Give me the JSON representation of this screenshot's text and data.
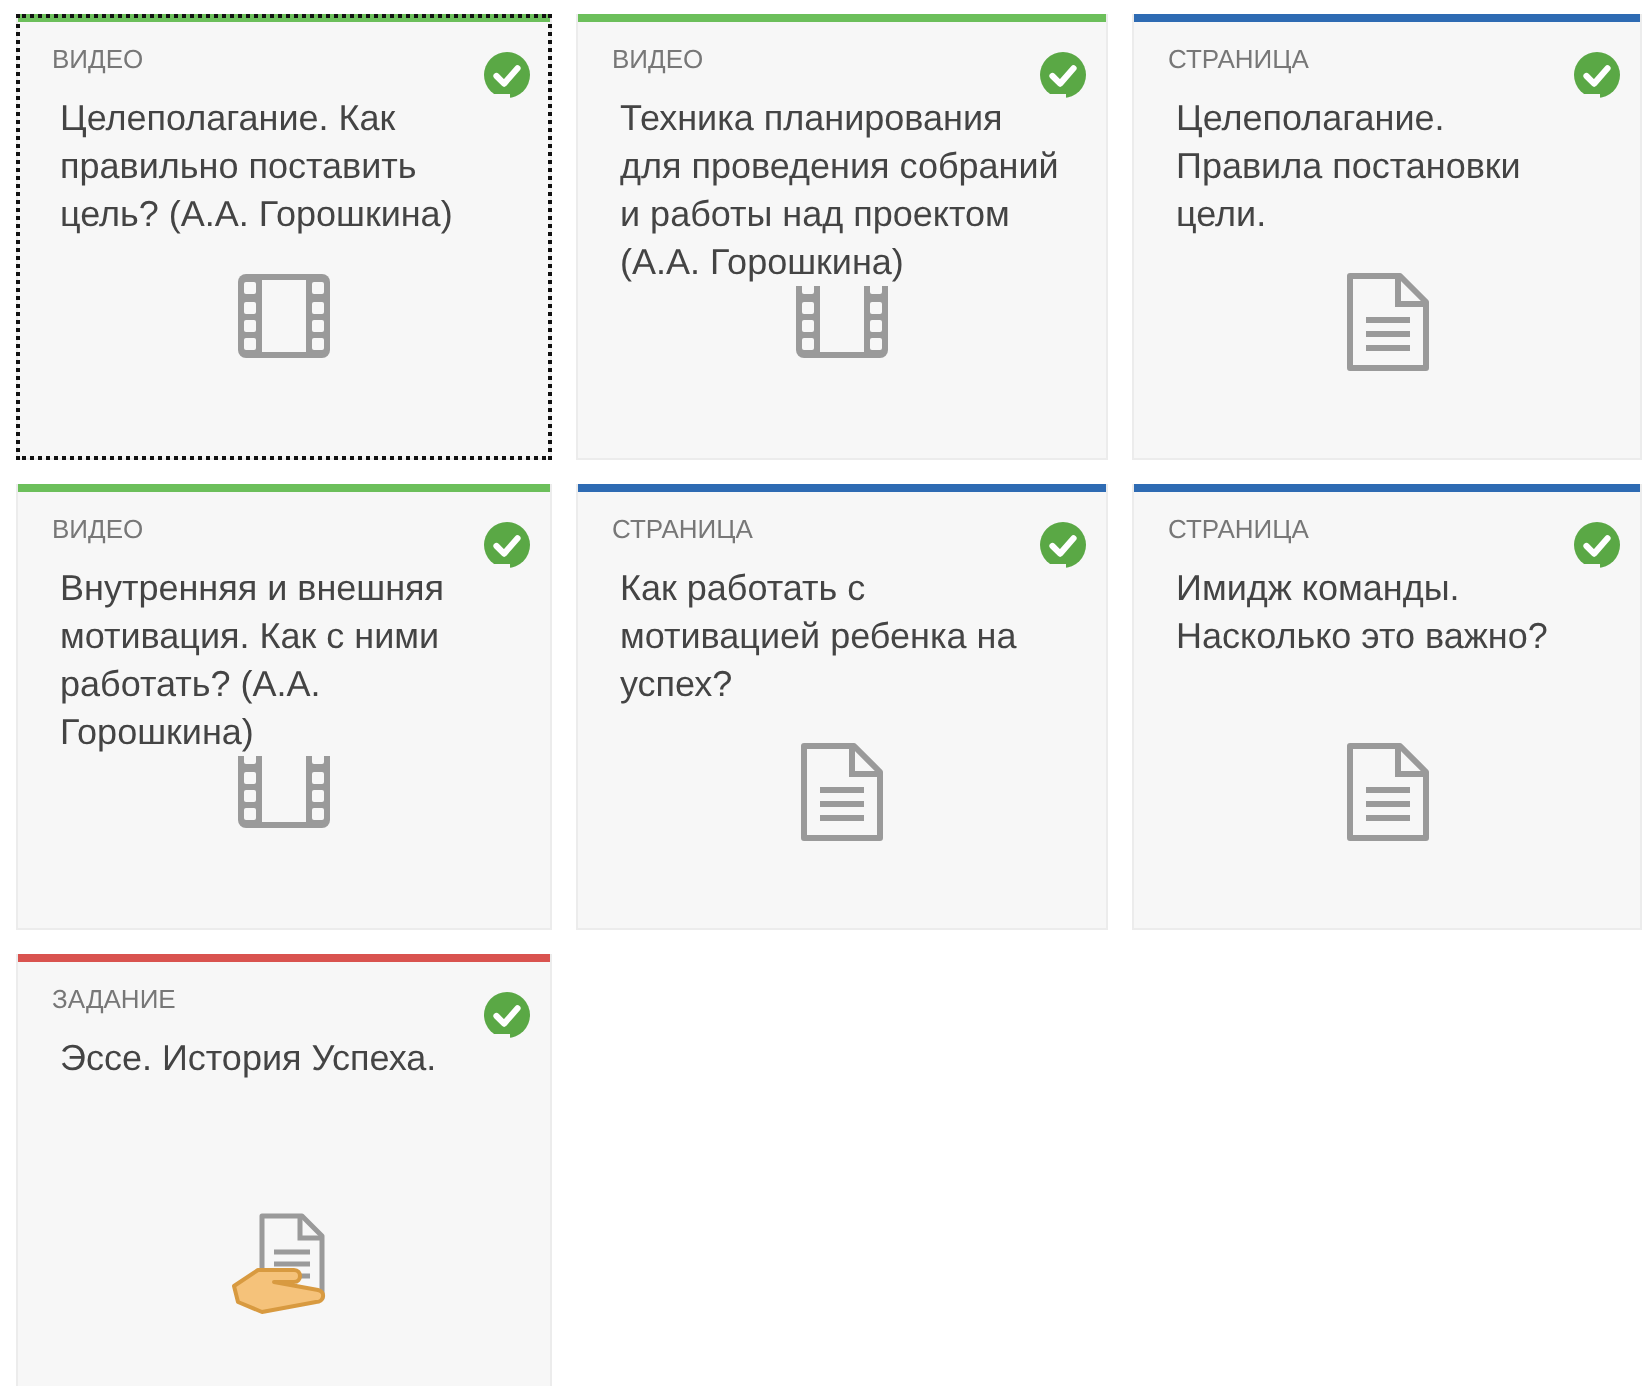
{
  "cards": [
    {
      "kind": "video",
      "type_label": "ВИДЕО",
      "title": "Целеполагание. Как правильно поставить цель? (А.А. Горошкина)",
      "completed": true,
      "focused": true
    },
    {
      "kind": "video",
      "type_label": "ВИДЕО",
      "title": "Техника планирования для проведения собраний и работы над проектом (А.А. Горошкина)",
      "completed": true,
      "focused": false
    },
    {
      "kind": "page",
      "type_label": "СТРАНИЦА",
      "title": "Целеполагание. Правила постановки цели.",
      "completed": true,
      "focused": false
    },
    {
      "kind": "video",
      "type_label": "ВИДЕО",
      "title": "Внутренняя и внешняя мотивация. Как с ними работать? (А.А. Горошкина)",
      "completed": true,
      "focused": false
    },
    {
      "kind": "page",
      "type_label": "СТРАНИЦА",
      "title": "Как работать с мотивацией ребенка на успех?",
      "completed": true,
      "focused": false
    },
    {
      "kind": "page",
      "type_label": "СТРАНИЦА",
      "title": "Имидж команды. Насколько это важно?",
      "completed": true,
      "focused": false
    },
    {
      "kind": "assignment",
      "type_label": "ЗАДАНИЕ",
      "title": "Эссе. История Успеха.",
      "completed": true,
      "focused": false
    }
  ]
}
